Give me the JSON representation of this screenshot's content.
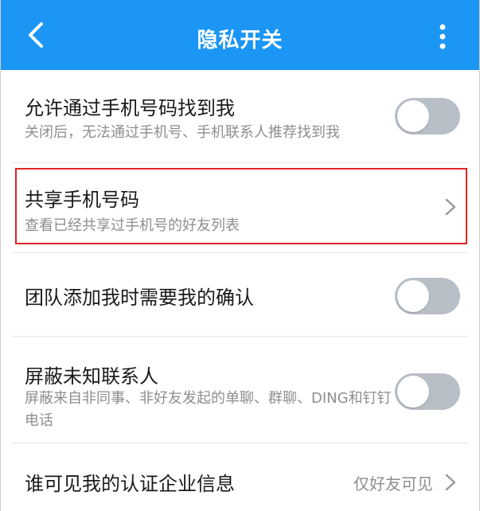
{
  "header": {
    "title": "隐私开关",
    "background": "#1c96f5",
    "back_icon": "chevron-left-icon",
    "more_icon": "vertical-dots-icon"
  },
  "settings": {
    "find_by_phone": {
      "label": "允许通过手机号码找到我",
      "description": "关闭后，无法通过手机号、手机联系人推荐找到我",
      "enabled": false
    },
    "share_phone": {
      "label": "共享手机号码",
      "description": "查看已经共享过手机号的好友列表",
      "icon": "chevron-right-icon",
      "highlight_color": "#e02424"
    },
    "team_confirm": {
      "label": "团队添加我时需要我的确认",
      "enabled": false
    },
    "block_unknown": {
      "label": "屏蔽未知联系人",
      "description": "屏蔽来自非同事、非好友发起的单聊、群聊、DING和钉钉电话",
      "enabled": false
    },
    "cert_visibility": {
      "label": "谁可见我的认证企业信息",
      "value": "仅好友可见",
      "icon": "chevron-right-icon"
    }
  }
}
